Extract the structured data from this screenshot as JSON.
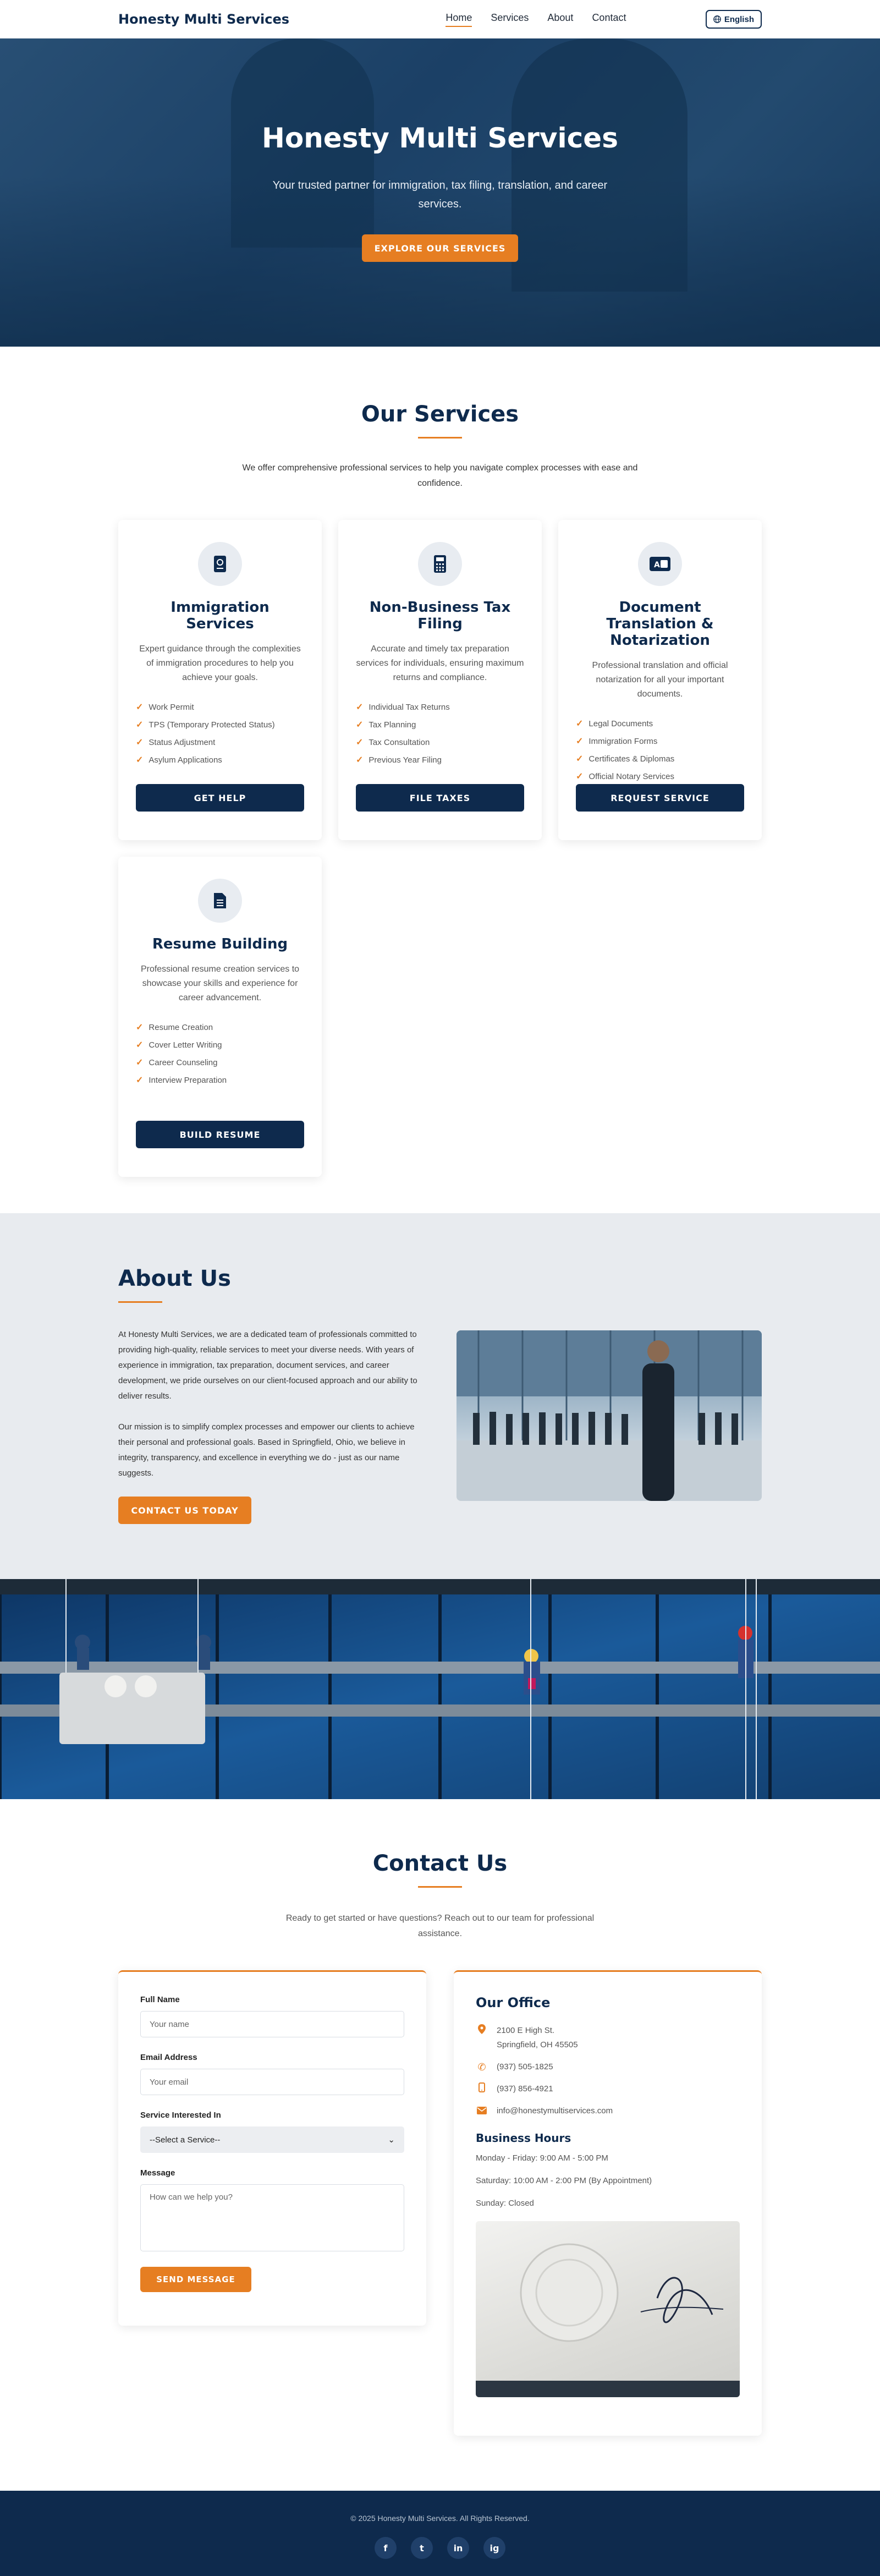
{
  "header": {
    "brand": "Honesty Multi Services",
    "nav": [
      "Home",
      "Services",
      "About",
      "Contact"
    ],
    "language": "English"
  },
  "hero": {
    "title": "Honesty Multi Services",
    "subtitle": "Your trusted partner for immigration, tax filing, translation, and career services.",
    "cta": "EXPLORE OUR SERVICES"
  },
  "services": {
    "title": "Our Services",
    "subtitle": "We offer comprehensive professional services to help you navigate complex processes with ease and confidence.",
    "cards": [
      {
        "icon": "passport-icon",
        "title": "Immigration Services",
        "desc": "Expert guidance through the complexities of immigration procedures to help you achieve your goals.",
        "items": [
          "Work Permit",
          "TPS (Temporary Protected Status)",
          "Status Adjustment",
          "Asylum Applications"
        ],
        "button": "GET HELP"
      },
      {
        "icon": "calculator-icon",
        "title": "Non-Business Tax Filing",
        "desc": "Accurate and timely tax preparation services for individuals, ensuring maximum returns and compliance.",
        "items": [
          "Individual Tax Returns",
          "Tax Planning",
          "Tax Consultation",
          "Previous Year Filing"
        ],
        "button": "FILE TAXES"
      },
      {
        "icon": "language-icon",
        "title": "Document Translation & Notarization",
        "desc": "Professional translation and official notarization for all your important documents.",
        "items": [
          "Legal Documents",
          "Immigration Forms",
          "Certificates & Diplomas",
          "Official Notary Services"
        ],
        "button": "REQUEST SERVICE"
      },
      {
        "icon": "document-icon",
        "title": "Resume Building",
        "desc": "Professional resume creation services to showcase your skills and experience for career advancement.",
        "items": [
          "Resume Creation",
          "Cover Letter Writing",
          "Career Counseling",
          "Interview Preparation"
        ],
        "button": "BUILD RESUME"
      }
    ]
  },
  "about": {
    "title": "About Us",
    "p1": "At Honesty Multi Services, we are a dedicated team of professionals committed to providing high-quality, reliable services to meet your diverse needs. With years of experience in immigration, tax preparation, document services, and career development, we pride ourselves on our client-focused approach and our ability to deliver results.",
    "p2": "Our mission is to simplify complex processes and empower our clients to achieve their personal and professional goals. Based in Springfield, Ohio, we believe in integrity, transparency, and excellence in everything we do - just as our name suggests.",
    "cta": "CONTACT US TODAY"
  },
  "contact": {
    "title": "Contact Us",
    "subtitle": "Ready to get started or have questions? Reach out to our team for professional assistance.",
    "form": {
      "name_label": "Full Name",
      "name_placeholder": "Your name",
      "email_label": "Email Address",
      "email_placeholder": "Your email",
      "service_label": "Service Interested In",
      "service_selected": "--Select a Service--",
      "message_label": "Message",
      "message_placeholder": "How can we help you?",
      "submit": "SEND MESSAGE"
    },
    "office": {
      "title": "Our Office",
      "address_line1": "2100 E High St.",
      "address_line2": "Springfield, OH 45505",
      "phone": "(937) 505-1825",
      "mobile": "(937) 856-4921",
      "email": "info@honestymultiservices.com",
      "hours_title": "Business Hours",
      "hours": [
        "Monday - Friday: 9:00 AM - 5:00 PM",
        "Saturday: 10:00 AM - 2:00 PM (By Appointment)",
        "Sunday: Closed"
      ]
    }
  },
  "footer": {
    "copyright": "© 2025 Honesty Multi Services. All Rights Reserved.",
    "social": [
      "f",
      "t",
      "in",
      "ig"
    ]
  },
  "colors": {
    "navy": "#0e2a4d",
    "accent": "#e67e22"
  }
}
